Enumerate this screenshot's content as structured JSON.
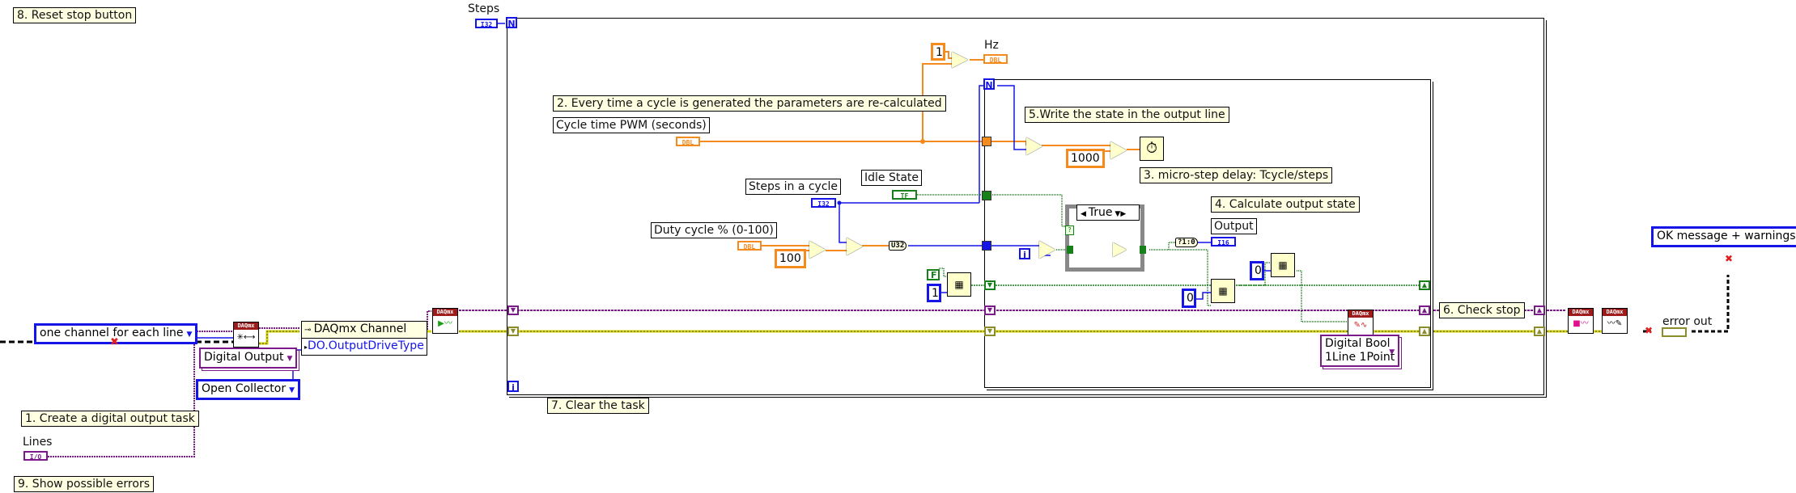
{
  "comments": {
    "c8": "8. Reset stop button",
    "c1": "1. Create a digital output task",
    "c9": "9. Show possible errors",
    "c2": "2. Every time a cycle is generated the parameters are re-calculated",
    "c5": "5.Write the state in the output line",
    "c3": "3. micro-step delay: Tcycle/steps",
    "c4": "4. Calculate output state",
    "c7": "7. Clear the task",
    "c6": "6. Check stop"
  },
  "controls": {
    "steps": {
      "label": "Steps",
      "type": "I32"
    },
    "lines": {
      "label": "Lines",
      "type": "I/O"
    },
    "cycle_time": {
      "label": "Cycle time PWM (seconds)",
      "type": "DBL"
    },
    "steps_in_cycle": {
      "label": "Steps in a cycle",
      "type": "I32"
    },
    "idle_state": {
      "label": "Idle State",
      "type": "TF"
    },
    "duty_cycle": {
      "label": "Duty cycle % (0-100)",
      "type": "DBL"
    }
  },
  "indicators": {
    "hz": {
      "label": "Hz",
      "type": "DBL"
    },
    "output": {
      "label": "Output",
      "type": "I16"
    },
    "error_out": {
      "label": "error out"
    }
  },
  "constants": {
    "one_hz": "1",
    "hundred": "100",
    "thousand": "1000",
    "zero_a": "0",
    "zero_b": "0",
    "one_size": "1",
    "false_bool": "F",
    "u32_convert": "U32",
    "bool_to_num": "?1:0"
  },
  "enums": {
    "line_grouping": "one channel for each line",
    "task_type": "Digital Output",
    "drive_type": "Open Collector",
    "write_mode": [
      "Digital Bool",
      "1Line 1Point"
    ],
    "error_mode": "OK message + warnings"
  },
  "property_node": {
    "class": "DAQmx Channel",
    "property": "DO.OutputDriveType"
  },
  "case_structure": {
    "selector": "True"
  },
  "vi_headers": {
    "daqmx": "DAQmx"
  },
  "loop_terminals": {
    "count": "N",
    "iteration": "i"
  },
  "colors": {
    "dbl_wire": "#f58a1f",
    "int_wire": "#1515e8",
    "bool_wire": "#17801a",
    "task_wire": "#7b1b8a",
    "error_wire": "#8c8c2a",
    "comment_bg": "#ffffe1",
    "daqmx_header": "#9e1b1b"
  }
}
